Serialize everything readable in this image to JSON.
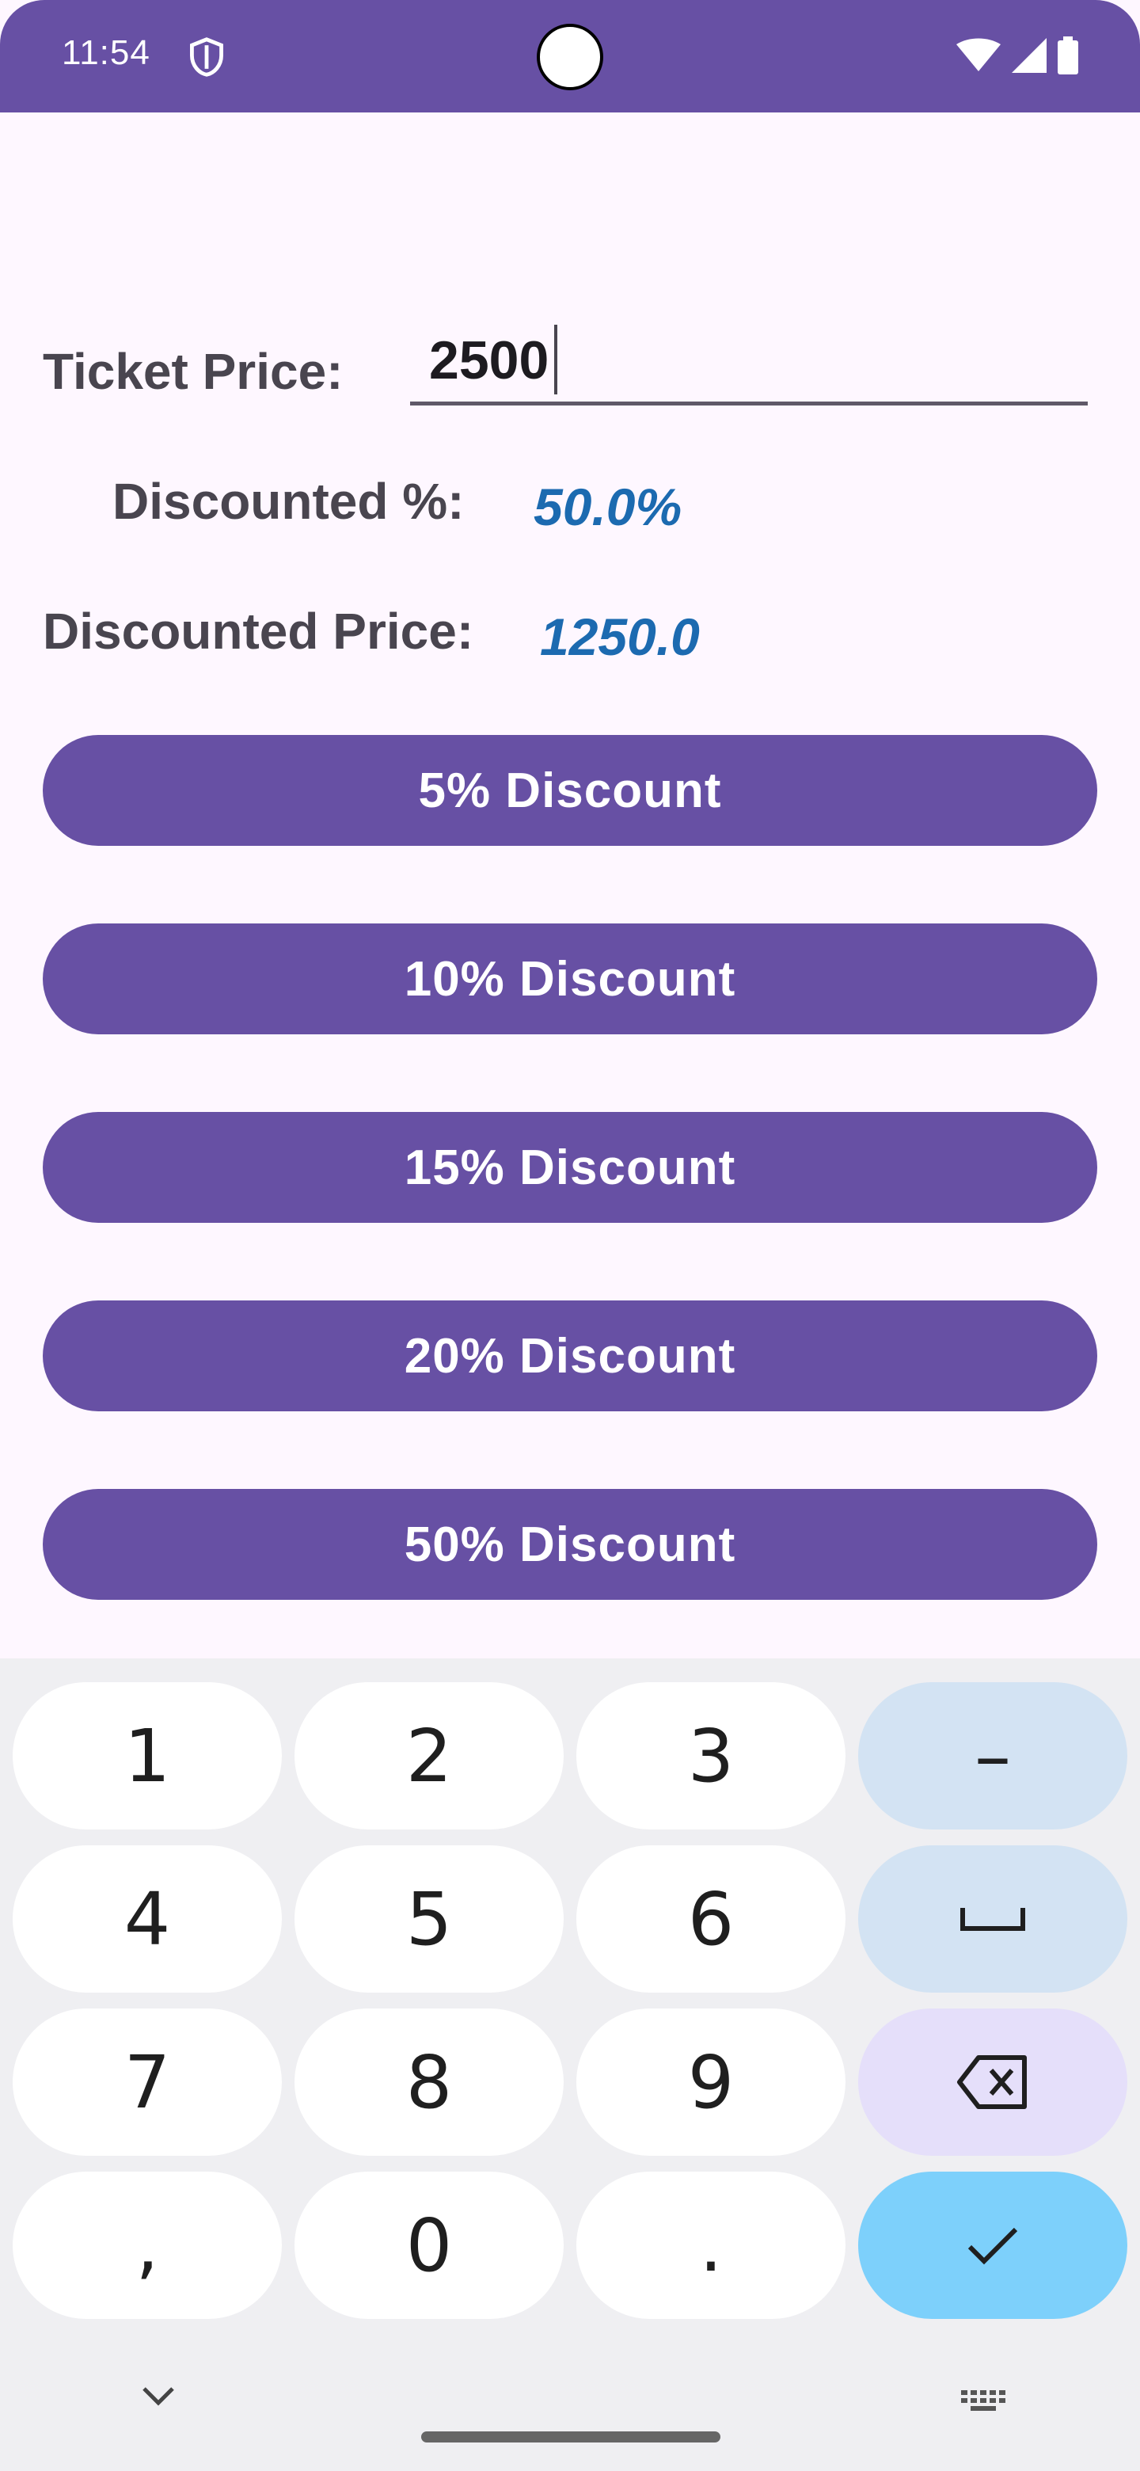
{
  "status_bar": {
    "time": "11:54",
    "icons": [
      "shield-icon",
      "wifi-icon",
      "signal-icon",
      "battery-icon"
    ],
    "color": "#6750a4"
  },
  "form": {
    "ticket_price_label": "Ticket Price:",
    "ticket_price_value": "2500",
    "discounted_pct_label": "Discounted %:",
    "discounted_pct_value": "50.0%",
    "discounted_price_label": "Discounted Price:",
    "discounted_price_value": "1250.0"
  },
  "buttons": [
    {
      "label": "5% Discount"
    },
    {
      "label": "10% Discount"
    },
    {
      "label": "15% Discount"
    },
    {
      "label": "20% Discount"
    },
    {
      "label": "50% Discount"
    }
  ],
  "keyboard": {
    "rows": [
      [
        "1",
        "2",
        "3",
        "–"
      ],
      [
        "4",
        "5",
        "6",
        "␣"
      ],
      [
        "7",
        "8",
        "9",
        "⌫"
      ],
      [
        ",",
        "0",
        ".",
        "✓"
      ]
    ],
    "icons": [
      "chevron-down-icon",
      "keyboard-icon"
    ]
  },
  "colors": {
    "accent": "#6750a4",
    "value_text": "#1c6ab0",
    "background": "#fef7ff"
  }
}
